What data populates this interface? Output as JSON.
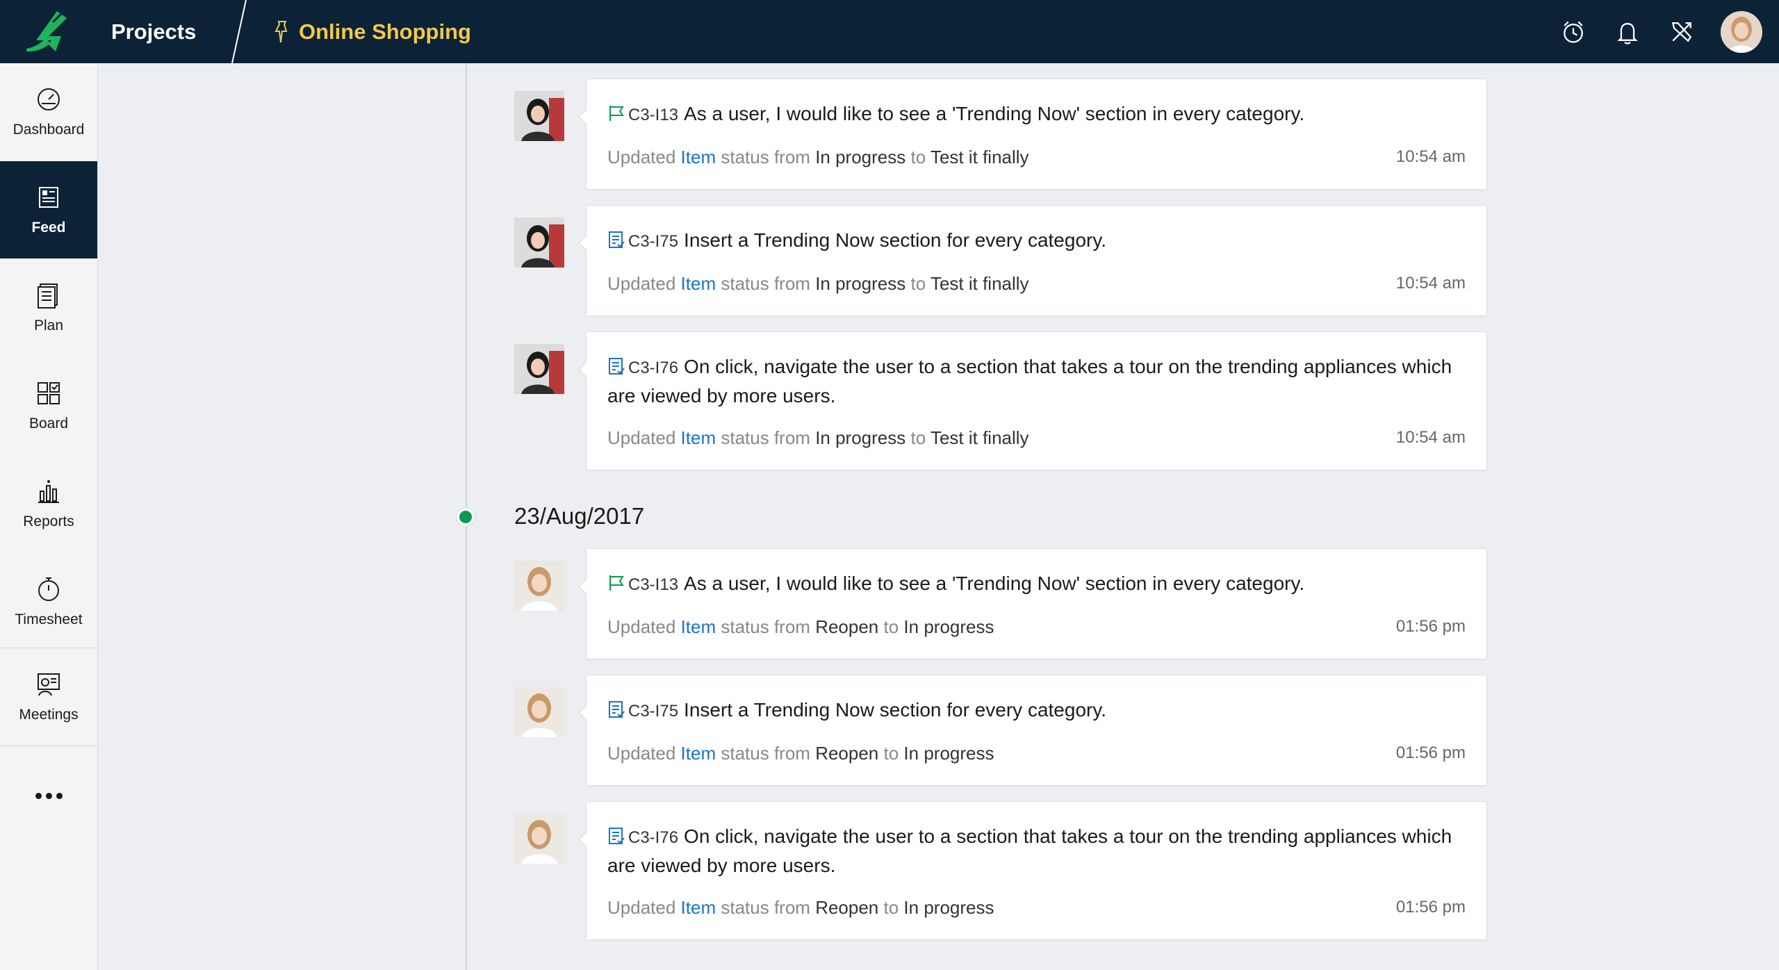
{
  "header": {
    "brand": "Projects",
    "project_name": "Online Shopping",
    "icons": [
      "timer-icon",
      "bell-icon",
      "tools-icon",
      "user-avatar"
    ]
  },
  "sidebar": {
    "items": [
      {
        "label": "Dashboard",
        "icon": "speedometer-icon",
        "active": false
      },
      {
        "label": "Feed",
        "icon": "feed-icon",
        "active": true
      },
      {
        "label": "Plan",
        "icon": "plan-icon",
        "active": false
      },
      {
        "label": "Board",
        "icon": "board-icon",
        "active": false
      },
      {
        "label": "Reports",
        "icon": "reports-icon",
        "active": false
      },
      {
        "label": "Timesheet",
        "icon": "stopwatch-icon",
        "active": false
      },
      {
        "label": "Meetings",
        "icon": "meetings-icon",
        "active": false
      }
    ],
    "more": "more-icon"
  },
  "feed": {
    "date_heading": "23/Aug/2017",
    "entries": [
      {
        "icon": "flag-icon",
        "id": "C3-I13",
        "title": "As a user, I would like to see a 'Trending Now' section in every category.",
        "updated": "Updated",
        "item": "Item",
        "status_from_text": "status from",
        "from": "In progress",
        "to_text": "to",
        "to": "Test it finally",
        "time": "10:54 am"
      },
      {
        "icon": "task-icon",
        "id": "C3-I75",
        "title": "Insert a Trending Now section for every category.",
        "updated": "Updated",
        "item": "Item",
        "status_from_text": "status from",
        "from": "In progress",
        "to_text": "to",
        "to": "Test it finally",
        "time": "10:54 am"
      },
      {
        "icon": "task-icon",
        "id": "C3-I76",
        "title": "On click, navigate the user to a section that takes a tour on the trending appliances which are viewed by more users.",
        "updated": "Updated",
        "item": "Item",
        "status_from_text": "status from",
        "from": "In progress",
        "to_text": "to",
        "to": "Test it finally",
        "time": "10:54 am"
      },
      {
        "icon": "flag-icon",
        "id": "C3-I13",
        "title": "As a user, I would like to see a 'Trending Now' section in every category.",
        "updated": "Updated",
        "item": "Item",
        "status_from_text": "status from",
        "from": "Reopen",
        "to_text": "to",
        "to": "In progress",
        "time": "01:56 pm"
      },
      {
        "icon": "task-icon",
        "id": "C3-I75",
        "title": "Insert a Trending Now section for every category.",
        "updated": "Updated",
        "item": "Item",
        "status_from_text": "status from",
        "from": "Reopen",
        "to_text": "to",
        "to": "In progress",
        "time": "01:56 pm"
      },
      {
        "icon": "task-icon",
        "id": "C3-I76",
        "title": "On click, navigate the user to a section that takes a tour on the trending appliances which are viewed by more users.",
        "updated": "Updated",
        "item": "Item",
        "status_from_text": "status from",
        "from": "Reopen",
        "to_text": "to",
        "to": "In progress",
        "time": "01:56 pm"
      }
    ]
  },
  "colors": {
    "topbar": "#0c2236",
    "accent_green": "#0a9b52",
    "project_yellow": "#f2c94c",
    "link_blue": "#1a73c8"
  }
}
